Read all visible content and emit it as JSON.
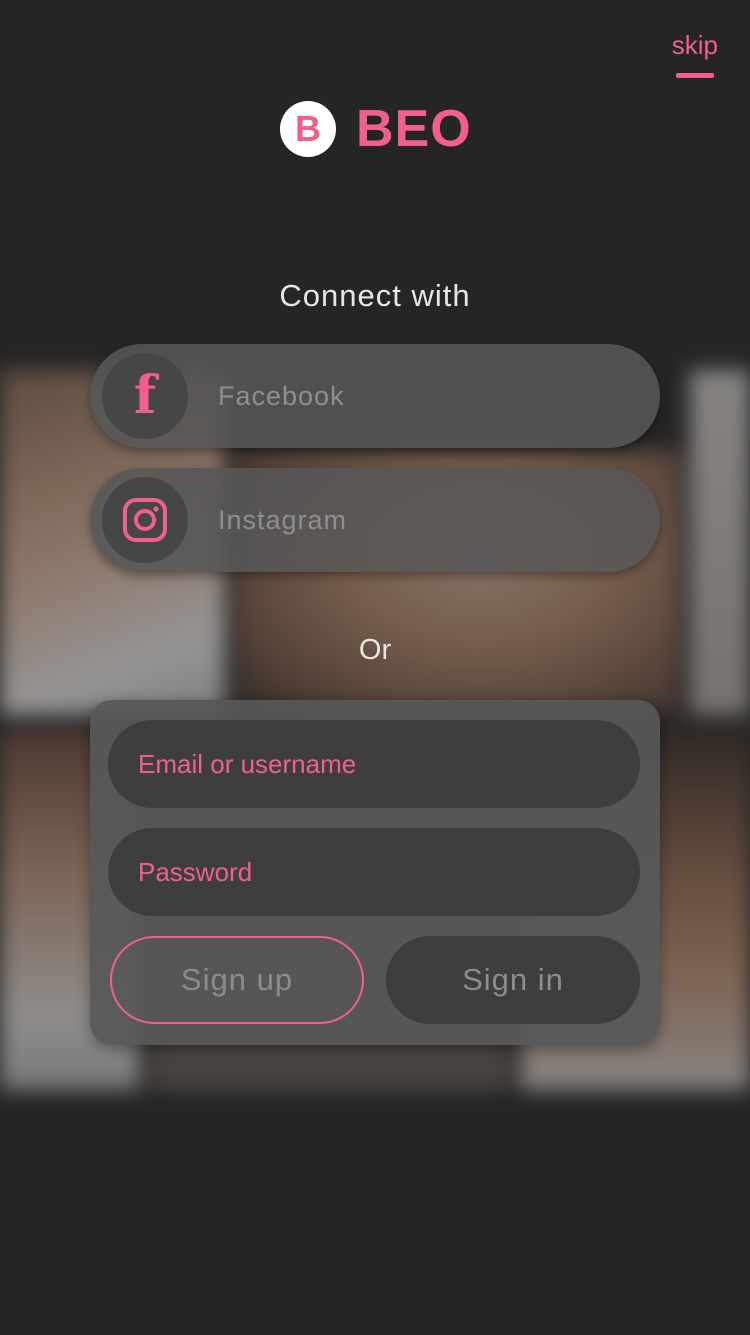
{
  "header": {
    "skip_label": "skip"
  },
  "brand": {
    "badge_letter": "B",
    "name": "BEO",
    "accent_color": "#f0608a"
  },
  "connect": {
    "title": "Connect with",
    "facebook_label": "Facebook",
    "instagram_label": "Instagram",
    "facebook_icon": "facebook-icon",
    "instagram_icon": "instagram-icon"
  },
  "divider": {
    "or_label": "Or"
  },
  "form": {
    "email_placeholder": "Email or username",
    "password_placeholder": "Password",
    "signup_label": "Sign up",
    "signin_label": "Sign in"
  }
}
